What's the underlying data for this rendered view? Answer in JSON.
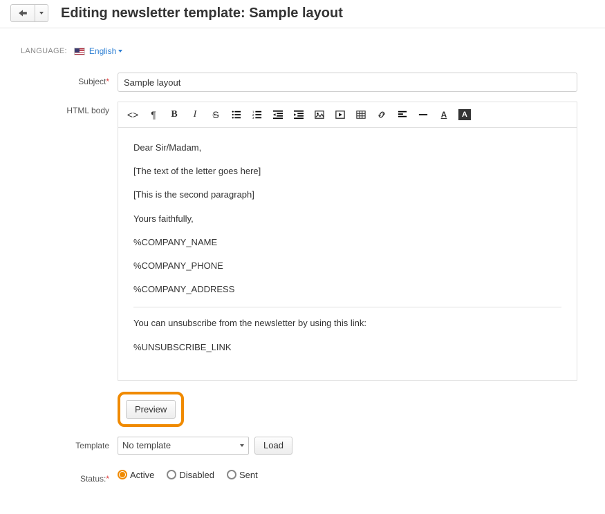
{
  "header": {
    "title": "Editing newsletter template: Sample layout"
  },
  "language": {
    "label": "LANGUAGE:",
    "value": "English"
  },
  "form": {
    "subject_label": "Subject",
    "subject_value": "Sample layout",
    "htmlbody_label": "HTML body",
    "preview_label": "Preview",
    "template_label": "Template",
    "template_value": "No template",
    "load_label": "Load",
    "status_label": "Status:",
    "status_options": {
      "active": "Active",
      "disabled": "Disabled",
      "sent": "Sent"
    }
  },
  "editor": {
    "p1": "Dear Sir/Madam,",
    "p2": "[The text of the letter goes here]",
    "p3": "[This is the second paragraph]",
    "p4": "Yours faithfully,",
    "p5": "%COMPANY_NAME",
    "p6": "%COMPANY_PHONE",
    "p7": "%COMPANY_ADDRESS",
    "p8": "You can unsubscribe from the newsletter by using this link:",
    "p9": "%UNSUBSCRIBE_LINK"
  }
}
